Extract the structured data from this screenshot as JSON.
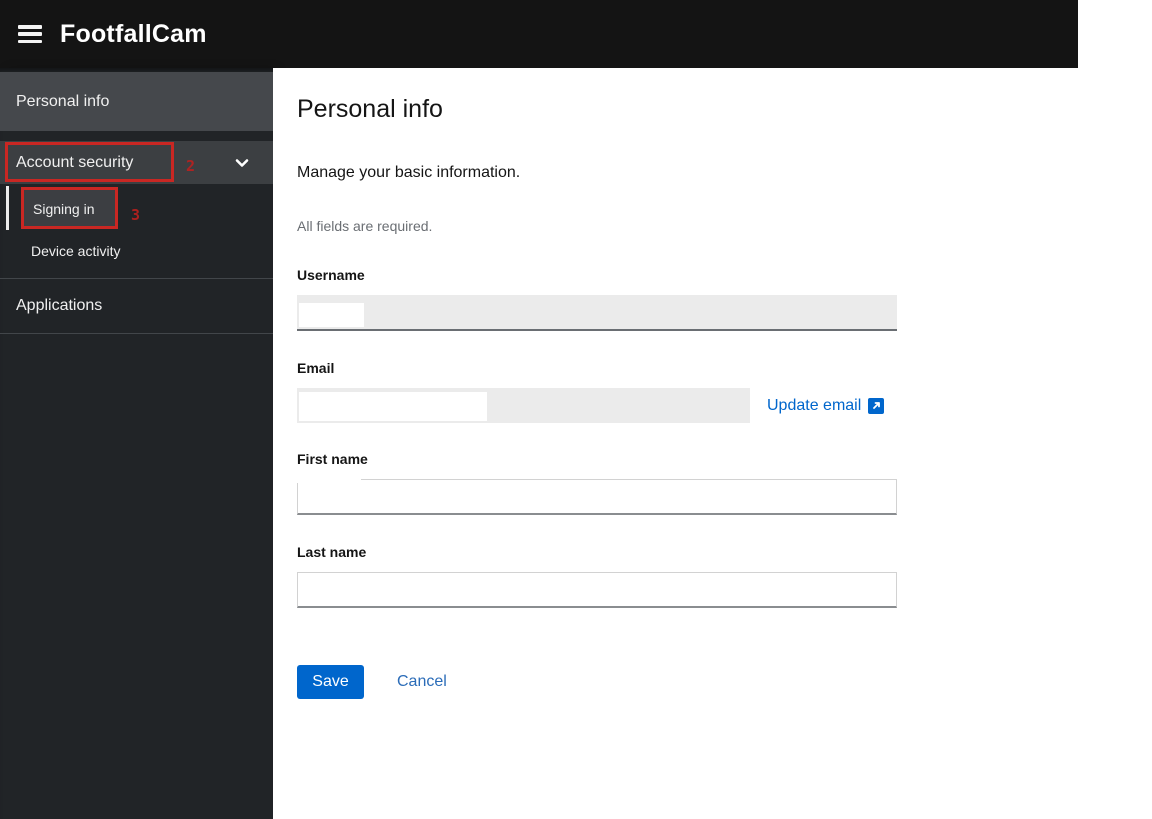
{
  "header": {
    "title": "FootfallCam",
    "menu_icon": "hamburger-icon"
  },
  "sidebar": {
    "items": [
      {
        "label": "Personal info",
        "state": "highlighted"
      },
      {
        "label": "Account security",
        "expanded": true,
        "icon": "chevron-down-icon",
        "children": [
          {
            "label": "Signing in",
            "state": "current"
          },
          {
            "label": "Device activity"
          }
        ]
      },
      {
        "label": "Applications"
      }
    ]
  },
  "main": {
    "title": "Personal info",
    "description": "Manage your basic information.",
    "required_note": "All fields are required.",
    "fields": [
      {
        "label": "Username",
        "value": "",
        "disabled": true,
        "redacted": true
      },
      {
        "label": "Email",
        "value": "",
        "disabled": true,
        "redacted": true
      },
      {
        "label": "First name",
        "value": ""
      },
      {
        "label": "Last name",
        "value": ""
      }
    ],
    "email_action": {
      "label": "Update email",
      "icon": "external-link-icon"
    },
    "buttons": {
      "save": "Save",
      "cancel": "Cancel"
    }
  },
  "annotations": [
    {
      "number": "2",
      "target": "Account security"
    },
    {
      "number": "3",
      "target": "Signing in"
    }
  ],
  "colors": {
    "header_bg": "#141414",
    "sidebar_bg": "#212427",
    "sidebar_highlight": "#45484c",
    "accent_blue": "#0066cc",
    "annotation_red": "#c92723",
    "disabled_input_bg": "#ebebeb"
  }
}
